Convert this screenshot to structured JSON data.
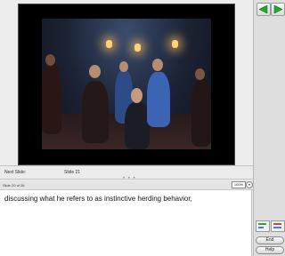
{
  "slide": {
    "description": ""
  },
  "next_slide": {
    "label": "Next Slide:",
    "value": "Slide 21"
  },
  "notes_header": {
    "slide_count": "Slide 20 of 26",
    "zoom": "100%",
    "zoom_dropdown_symbol": "▾"
  },
  "notes": {
    "text": "discussing what he refers to as instinctive herding behavior,"
  },
  "sidebar": {
    "prev_icon": "green-left-arrow-icon",
    "next_icon": "green-right-arrow-icon",
    "end_label": "End",
    "help_label": "Help"
  },
  "colors": {
    "arrow_green": "#25a631",
    "slide_frame": "#000000",
    "notes_background": "#ffffff"
  }
}
